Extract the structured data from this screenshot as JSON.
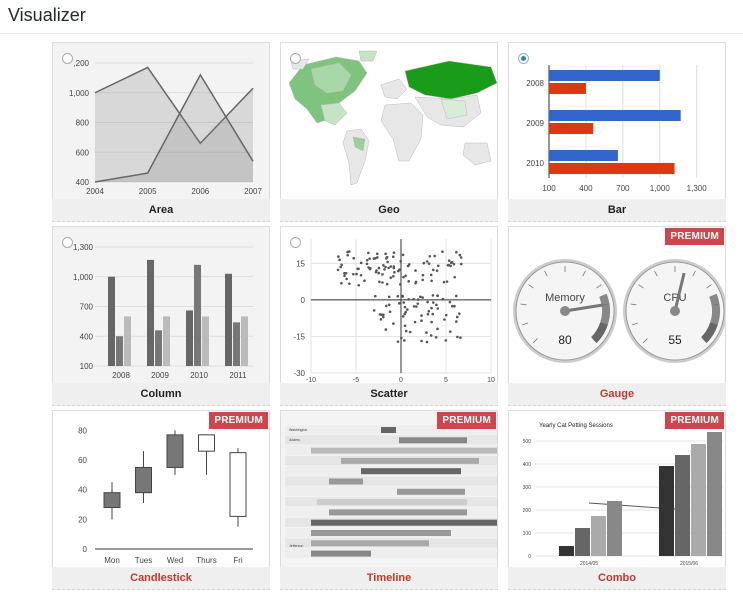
{
  "app": {
    "title": "Visualizer"
  },
  "cards": [
    {
      "label": "Area",
      "premium": false,
      "selected": false
    },
    {
      "label": "Geo",
      "premium": false,
      "selected": false
    },
    {
      "label": "Bar",
      "premium": false,
      "selected": true
    },
    {
      "label": "Column",
      "premium": false,
      "selected": false
    },
    {
      "label": "Scatter",
      "premium": false,
      "selected": false
    },
    {
      "label": "Gauge",
      "premium": true,
      "selected": false
    },
    {
      "label": "Candlestick",
      "premium": true,
      "selected": false
    },
    {
      "label": "Timeline",
      "premium": true,
      "selected": false
    },
    {
      "label": "Combo",
      "premium": true,
      "selected": false
    }
  ],
  "premium_badge": "PREMIUM",
  "chart_data": [
    {
      "type": "area",
      "x": [
        "2004",
        "2005",
        "2006",
        "2007"
      ],
      "yticks": [
        ",200",
        "1,000",
        "800",
        "600",
        "400"
      ],
      "series": [
        {
          "values": [
            1000,
            1170,
            660,
            1030
          ]
        },
        {
          "values": [
            400,
            460,
            1120,
            540
          ]
        }
      ],
      "ylim": [
        400,
        1200
      ]
    },
    {
      "type": "map"
    },
    {
      "type": "bar",
      "categories": [
        "2008",
        "2009",
        "2010"
      ],
      "xticks": [
        "100",
        "400",
        "700",
        "1,000",
        "1,300"
      ],
      "series": [
        {
          "values": [
            1000,
            1170,
            660
          ]
        },
        {
          "values": [
            400,
            460,
            1120
          ]
        }
      ],
      "xlim": [
        100,
        1400
      ],
      "colors": [
        "#3366cc",
        "#dc3912"
      ]
    },
    {
      "type": "bar",
      "categories": [
        "2008",
        "2009",
        "2010",
        "2011"
      ],
      "yticks": [
        "1,300",
        "1,000",
        "700",
        "400",
        "100"
      ],
      "series": [
        {
          "values": [
            1000,
            1170,
            660,
            1030
          ]
        },
        {
          "values": [
            400,
            460,
            1120,
            540
          ]
        },
        {
          "values": [
            600,
            600,
            600,
            600
          ]
        }
      ],
      "ylim": [
        100,
        1300
      ]
    },
    {
      "type": "scatter",
      "xticks": [
        "-10",
        "-5",
        "0",
        "5",
        "10"
      ],
      "yticks": [
        "15",
        "0",
        "-15",
        "-30"
      ],
      "xlim": [
        -10,
        10
      ],
      "ylim": [
        -30,
        25
      ]
    },
    {
      "type": "gauge",
      "gauges": [
        {
          "label": "Memory",
          "value": 80
        },
        {
          "label": "CPU",
          "value": 55
        }
      ]
    },
    {
      "type": "candlestick",
      "categories": [
        "Mon",
        "Tues",
        "Wed",
        "Thurs",
        "Fri"
      ],
      "yticks": [
        "80",
        "60",
        "40",
        "20",
        "0"
      ],
      "candles": [
        [
          20,
          28,
          38,
          45
        ],
        [
          31,
          38,
          55,
          66
        ],
        [
          50,
          55,
          77,
          80
        ],
        [
          50,
          66,
          77,
          77
        ],
        [
          15,
          22,
          65,
          68
        ]
      ],
      "ylim": [
        0,
        85
      ]
    },
    {
      "type": "timeline",
      "rows": [
        "Washington",
        "Adams",
        "Jefferson"
      ]
    },
    {
      "type": "combo",
      "title": "Yearly Cat Petting Sessions",
      "categories": [
        "2014/05",
        "2015/06"
      ]
    }
  ]
}
